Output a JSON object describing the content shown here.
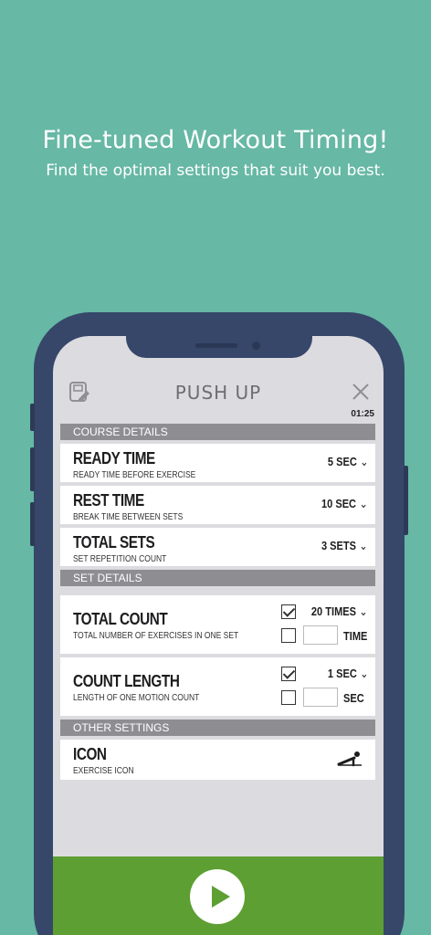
{
  "promo": {
    "title": "Fine-tuned Workout Timing!",
    "subtitle": "Find the optimal settings that suit you best."
  },
  "header": {
    "title": "PUSH UP",
    "timer": "01:25",
    "icons": {
      "left": "edit-document-icon",
      "right": "close-icon"
    }
  },
  "sections": {
    "course": {
      "title": "COURSE DETAILS",
      "ready": {
        "label": "READY TIME",
        "desc": "READY TIME BEFORE EXERCISE",
        "value": "5 SEC"
      },
      "rest": {
        "label": "REST TIME",
        "desc": "BREAK TIME BETWEEN SETS",
        "value": "10 SEC"
      },
      "sets": {
        "label": "TOTAL SETS",
        "desc": "SET REPETITION COUNT",
        "value": "3 SETS"
      }
    },
    "set": {
      "title": "SET DETAILS",
      "count": {
        "label": "TOTAL COUNT",
        "desc": "TOTAL NUMBER OF EXERCISES IN ONE SET",
        "value": "20 TIMES",
        "unit": "TIME",
        "option1_checked": true,
        "option2_checked": false
      },
      "length": {
        "label": "COUNT LENGTH",
        "desc": "LENGTH OF ONE MOTION COUNT",
        "value": "1 SEC",
        "unit": "SEC",
        "option1_checked": true,
        "option2_checked": false
      }
    },
    "other": {
      "title": "OTHER SETTINGS",
      "icon": {
        "label": "ICON",
        "desc": "EXERCISE ICON",
        "icon": "pushup-icon"
      }
    }
  },
  "footer": {
    "icon": "play-icon"
  },
  "colors": {
    "background": "#67b8a5",
    "phone": "#36476a",
    "accent": "#5d9f32",
    "section": "#8e8e92"
  }
}
